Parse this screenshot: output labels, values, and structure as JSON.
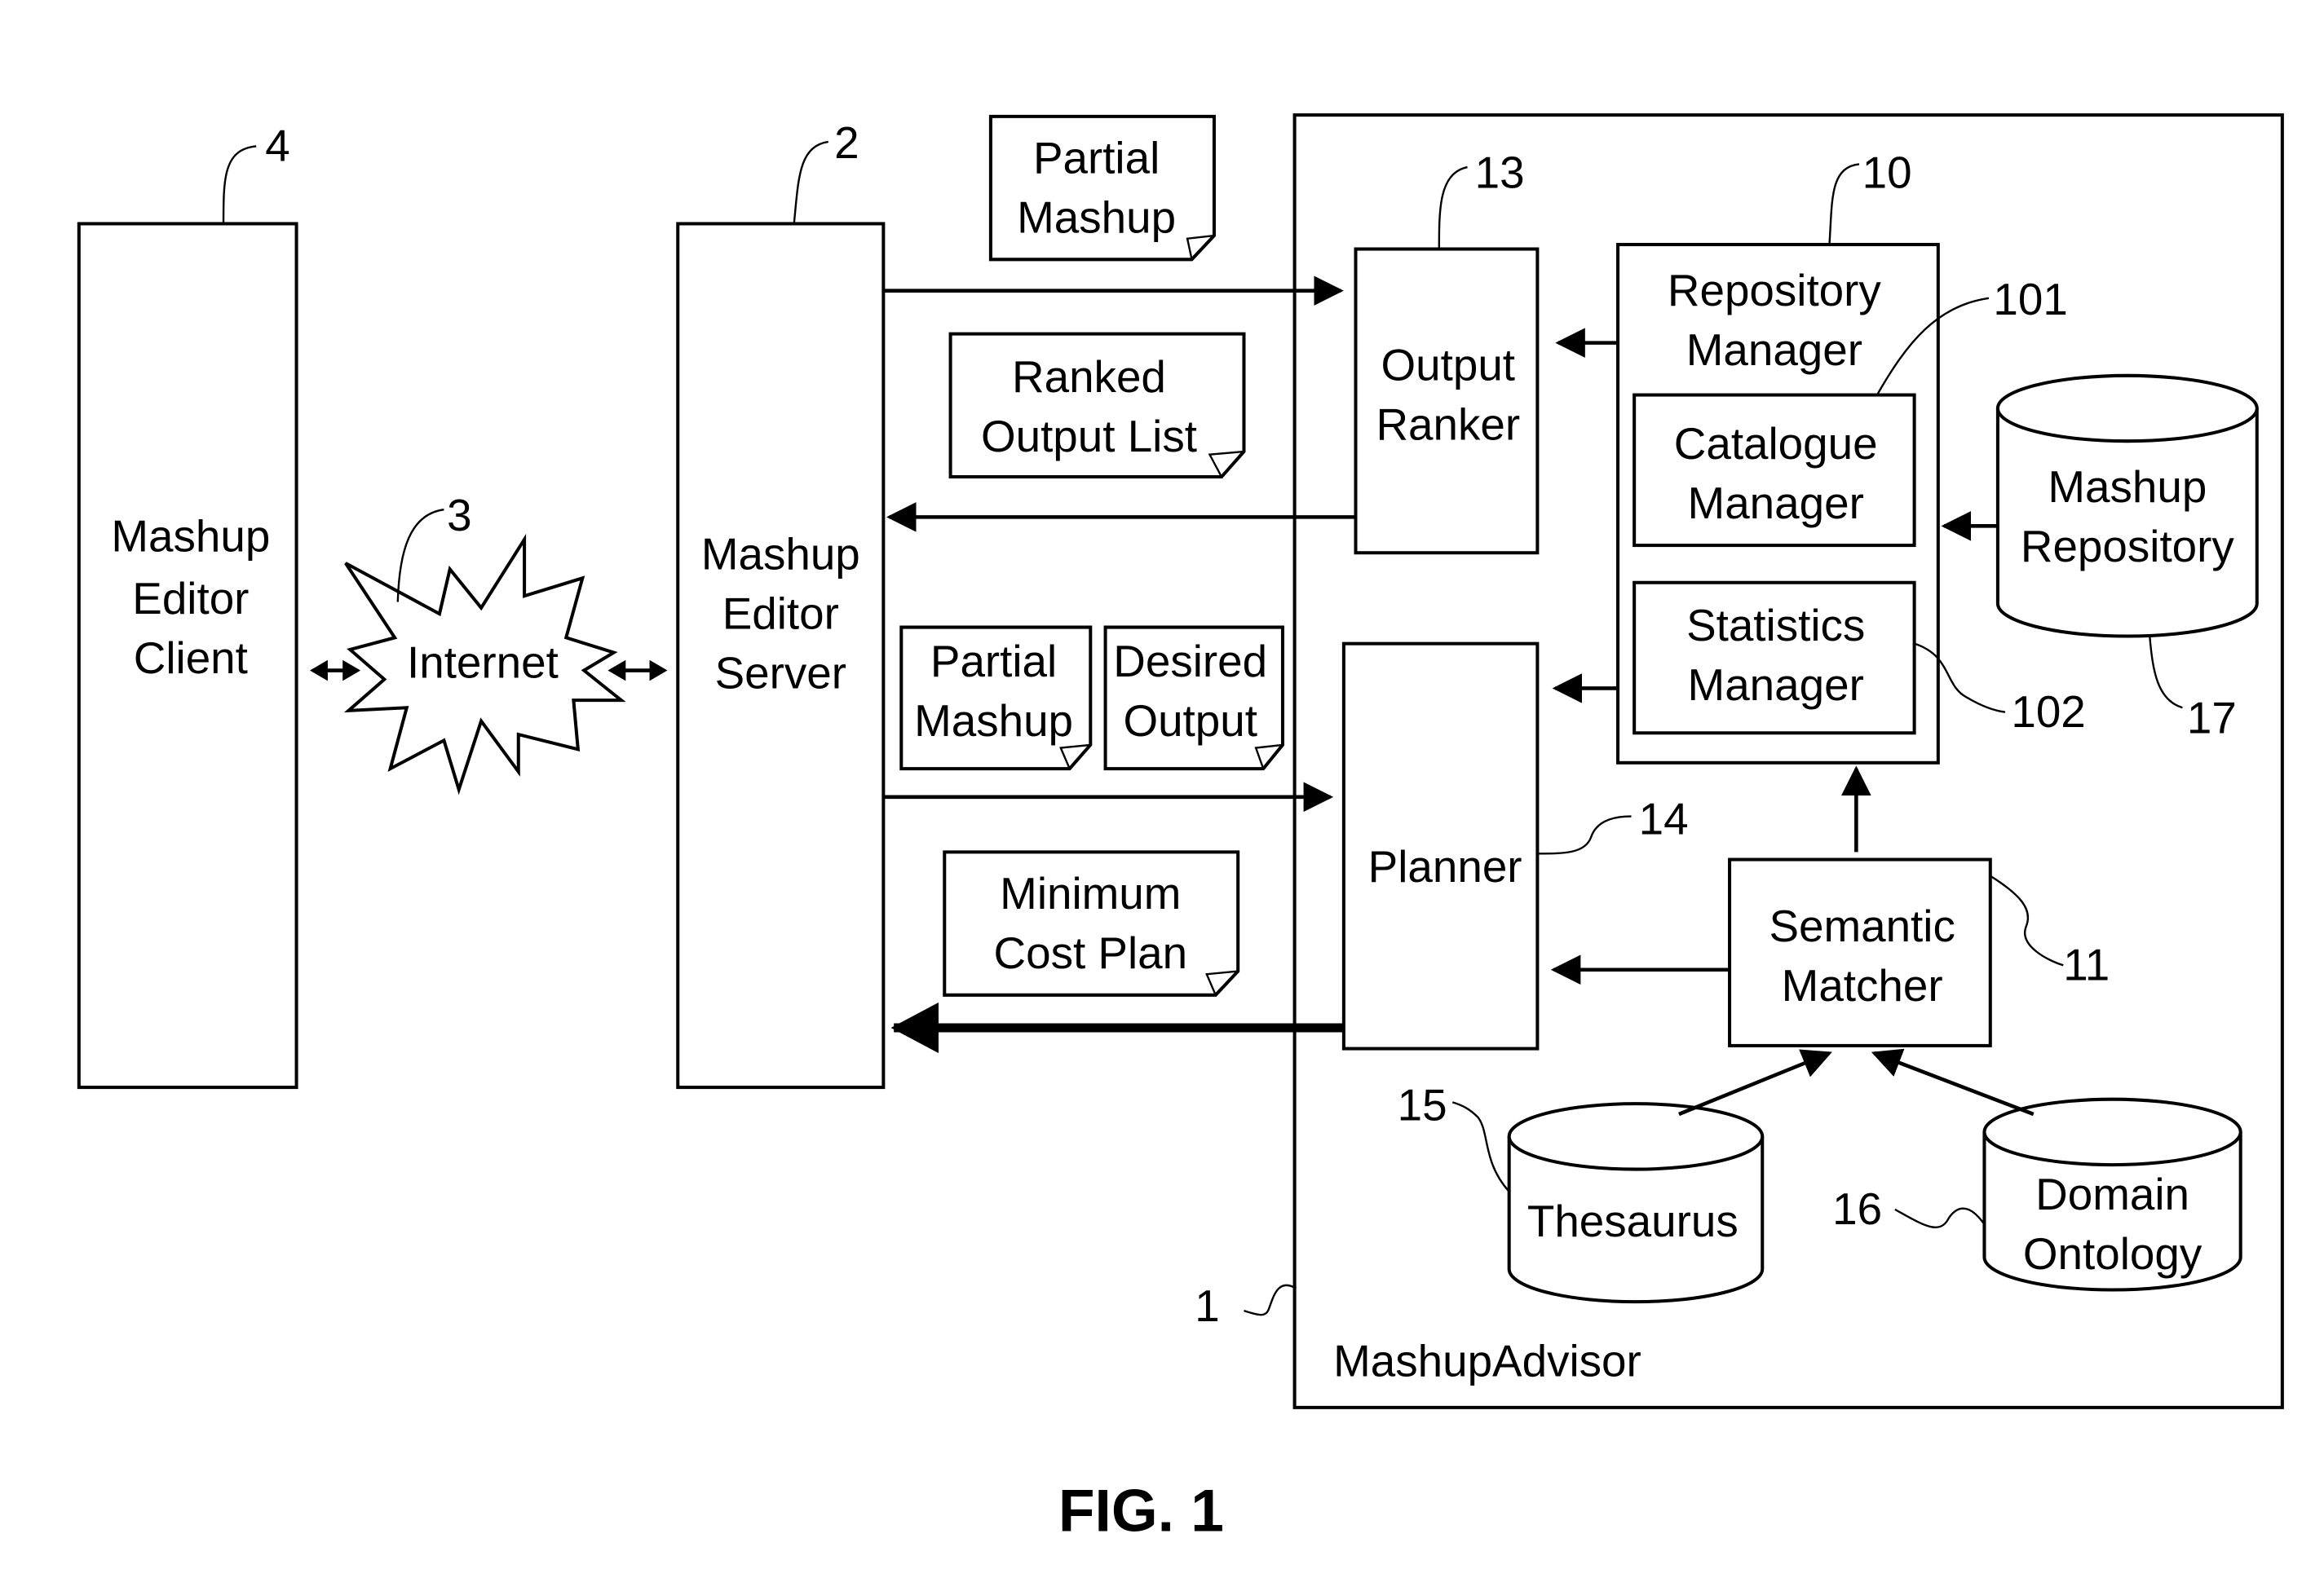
{
  "figure": {
    "caption": "FIG. 1",
    "components": {
      "client": {
        "lines": [
          "Mashup",
          "Editor",
          "Client"
        ],
        "ref": "4"
      },
      "internet": {
        "label": "Internet",
        "ref": "3"
      },
      "server": {
        "lines": [
          "Mashup",
          "Editor",
          "Server"
        ],
        "ref": "2"
      },
      "advisor": {
        "label": "MashupAdvisor",
        "ref": "1"
      },
      "output_ranker": {
        "lines": [
          "Output",
          "Ranker"
        ],
        "ref": "13"
      },
      "repository_manager": {
        "lines": [
          "Repository",
          "Manager"
        ],
        "ref": "10"
      },
      "catalogue_manager": {
        "lines": [
          "Catalogue",
          "Manager"
        ],
        "ref": "101"
      },
      "statistics_manager": {
        "lines": [
          "Statistics",
          "Manager"
        ],
        "ref": "102"
      },
      "mashup_repository": {
        "lines": [
          "Mashup",
          "Repository"
        ],
        "ref": "17"
      },
      "planner": {
        "label": "Planner",
        "ref": "14"
      },
      "semantic_matcher": {
        "lines": [
          "Semantic",
          "Matcher"
        ],
        "ref": "11"
      },
      "thesaurus": {
        "label": "Thesaurus",
        "ref": "15"
      },
      "domain_ontology": {
        "lines": [
          "Domain",
          "Ontology"
        ],
        "ref": "16"
      }
    },
    "documents": {
      "partial_mashup_top": [
        "Partial",
        "Mashup"
      ],
      "ranked_output_list": [
        "Ranked",
        "Output List"
      ],
      "partial_mashup_mid": [
        "Partial",
        "Mashup"
      ],
      "desired_output": [
        "Desired",
        "Output"
      ],
      "minimum_cost_plan": [
        "Minimum",
        "Cost Plan"
      ]
    }
  }
}
